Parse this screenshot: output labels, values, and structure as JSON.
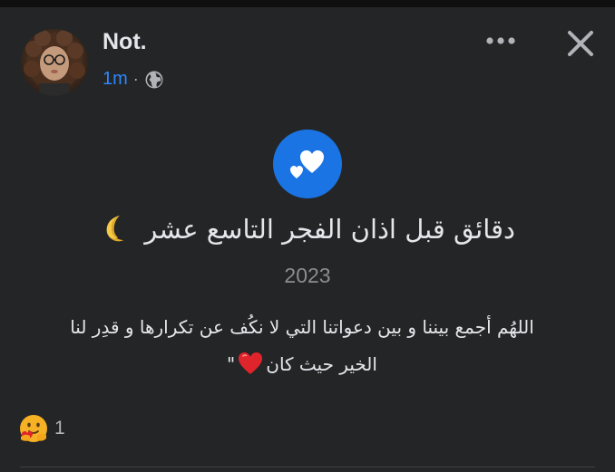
{
  "post": {
    "author_name": "Not.",
    "timestamp": "1m",
    "separator": "·",
    "audience_icon": "globe-icon",
    "more_icon": "more-horizontal-icon",
    "close_icon": "close-icon",
    "feeling_icon": "hearts-icon",
    "headline": "دقائق قبل اذان الفجر التاسع عشر",
    "headline_emoji": "crescent-moon-icon",
    "year": "2023",
    "body_line1": "اللهُم أجمع بيننا و بين دعواتنا التي لا نكُف عن تكرارها و قدِر لنا",
    "body_line2_text": "الخير حيث كان",
    "body_line2_end": "\"",
    "body_emoji": "red-heart-icon",
    "reaction_icon": "care-reaction-icon",
    "reaction_count": "1"
  },
  "colors": {
    "background": "#242526",
    "accent": "#1b74e4",
    "link": "#2d88ff",
    "text_primary": "#e4e6eb",
    "text_secondary": "#b0b3b8"
  }
}
